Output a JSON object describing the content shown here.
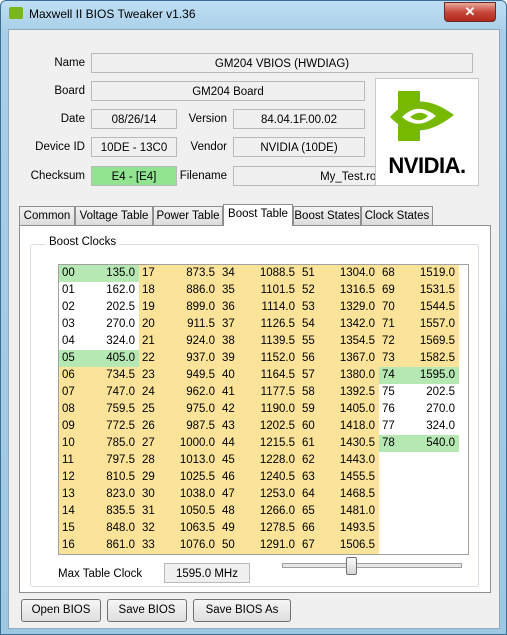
{
  "window": {
    "title": "Maxwell II BIOS Tweaker v1.36",
    "close_label": "✕"
  },
  "info": {
    "name_label": "Name",
    "name_value": "GM204 VBIOS (HWDIAG)",
    "board_label": "Board",
    "board_value": "GM204 Board",
    "date_label": "Date",
    "date_value": "08/26/14",
    "version_label": "Version",
    "version_value": "84.04.1F.00.02",
    "device_label": "Device ID",
    "device_value": "10DE - 13C0",
    "vendor_label": "Vendor",
    "vendor_value": "NVIDIA (10DE)",
    "checksum_label": "Checksum",
    "checksum_value": "E4 - [E4]",
    "filename_label": "Filename",
    "filename_value": "My_Test.rom"
  },
  "logo": {
    "text": "NVIDIA.",
    "icon": "nvidia-eye-icon",
    "accent": "#76b900"
  },
  "tabs": [
    "Common",
    "Voltage Table",
    "Power Table",
    "Boost Table",
    "Boost States",
    "Clock States"
  ],
  "active_tab": "Boost Table",
  "boost": {
    "group_title": "Boost Clocks",
    "max_clock_label": "Max Table Clock",
    "max_clock_value": "1595.0 MHz",
    "slider_level": 0.38,
    "colors": {
      "yellow": "#fbe49a",
      "green": "#b6e8b3",
      "white": "#ffffff"
    },
    "columns": [
      [
        [
          "00",
          "135.0",
          "g"
        ],
        [
          "01",
          "162.0",
          "w"
        ],
        [
          "02",
          "202.5",
          "w"
        ],
        [
          "03",
          "270.0",
          "w"
        ],
        [
          "04",
          "324.0",
          "w"
        ],
        [
          "05",
          "405.0",
          "g"
        ],
        [
          "06",
          "734.5",
          "y"
        ],
        [
          "07",
          "747.0",
          "y"
        ],
        [
          "08",
          "759.5",
          "y"
        ],
        [
          "09",
          "772.5",
          "y"
        ],
        [
          "10",
          "785.0",
          "y"
        ],
        [
          "11",
          "797.5",
          "y"
        ],
        [
          "12",
          "810.5",
          "y"
        ],
        [
          "13",
          "823.0",
          "y"
        ],
        [
          "14",
          "835.5",
          "y"
        ],
        [
          "15",
          "848.0",
          "y"
        ],
        [
          "16",
          "861.0",
          "y"
        ]
      ],
      [
        [
          "17",
          "873.5",
          "y"
        ],
        [
          "18",
          "886.0",
          "y"
        ],
        [
          "19",
          "899.0",
          "y"
        ],
        [
          "20",
          "911.5",
          "y"
        ],
        [
          "21",
          "924.0",
          "y"
        ],
        [
          "22",
          "937.0",
          "y"
        ],
        [
          "23",
          "949.5",
          "y"
        ],
        [
          "24",
          "962.0",
          "y"
        ],
        [
          "25",
          "975.0",
          "y"
        ],
        [
          "26",
          "987.5",
          "y"
        ],
        [
          "27",
          "1000.0",
          "y"
        ],
        [
          "28",
          "1013.0",
          "y"
        ],
        [
          "29",
          "1025.5",
          "y"
        ],
        [
          "30",
          "1038.0",
          "y"
        ],
        [
          "31",
          "1050.5",
          "y"
        ],
        [
          "32",
          "1063.5",
          "y"
        ],
        [
          "33",
          "1076.0",
          "y"
        ]
      ],
      [
        [
          "34",
          "1088.5",
          "y"
        ],
        [
          "35",
          "1101.5",
          "y"
        ],
        [
          "36",
          "1114.0",
          "y"
        ],
        [
          "37",
          "1126.5",
          "y"
        ],
        [
          "38",
          "1139.5",
          "y"
        ],
        [
          "39",
          "1152.0",
          "y"
        ],
        [
          "40",
          "1164.5",
          "y"
        ],
        [
          "41",
          "1177.5",
          "y"
        ],
        [
          "42",
          "1190.0",
          "y"
        ],
        [
          "43",
          "1202.5",
          "y"
        ],
        [
          "44",
          "1215.5",
          "y"
        ],
        [
          "45",
          "1228.0",
          "y"
        ],
        [
          "46",
          "1240.5",
          "y"
        ],
        [
          "47",
          "1253.0",
          "y"
        ],
        [
          "48",
          "1266.0",
          "y"
        ],
        [
          "49",
          "1278.5",
          "y"
        ],
        [
          "50",
          "1291.0",
          "y"
        ]
      ],
      [
        [
          "51",
          "1304.0",
          "y"
        ],
        [
          "52",
          "1316.5",
          "y"
        ],
        [
          "53",
          "1329.0",
          "y"
        ],
        [
          "54",
          "1342.0",
          "y"
        ],
        [
          "55",
          "1354.5",
          "y"
        ],
        [
          "56",
          "1367.0",
          "y"
        ],
        [
          "57",
          "1380.0",
          "y"
        ],
        [
          "58",
          "1392.5",
          "y"
        ],
        [
          "59",
          "1405.0",
          "y"
        ],
        [
          "60",
          "1418.0",
          "y"
        ],
        [
          "61",
          "1430.5",
          "y"
        ],
        [
          "62",
          "1443.0",
          "y"
        ],
        [
          "63",
          "1455.5",
          "y"
        ],
        [
          "64",
          "1468.5",
          "y"
        ],
        [
          "65",
          "1481.0",
          "y"
        ],
        [
          "66",
          "1493.5",
          "y"
        ],
        [
          "67",
          "1506.5",
          "y"
        ]
      ],
      [
        [
          "68",
          "1519.0",
          "y"
        ],
        [
          "69",
          "1531.5",
          "y"
        ],
        [
          "70",
          "1544.5",
          "y"
        ],
        [
          "71",
          "1557.0",
          "y"
        ],
        [
          "72",
          "1569.5",
          "y"
        ],
        [
          "73",
          "1582.5",
          "y"
        ],
        [
          "74",
          "1595.0",
          "g"
        ],
        [
          "75",
          "202.5",
          "w"
        ],
        [
          "76",
          "270.0",
          "w"
        ],
        [
          "77",
          "324.0",
          "w"
        ],
        [
          "78",
          "540.0",
          "g"
        ]
      ]
    ]
  },
  "footer": {
    "open_label": "Open BIOS",
    "save_label": "Save BIOS",
    "save_as_label": "Save BIOS As"
  }
}
